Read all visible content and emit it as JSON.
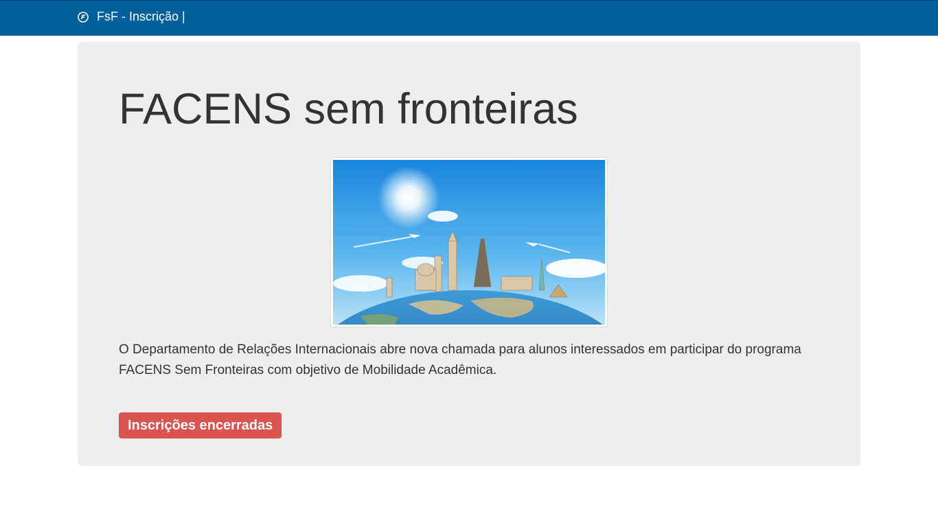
{
  "navbar": {
    "brand_label": "FsF - Inscrição |",
    "brand_icon": "facens-logo-icon",
    "background_color": "#04609c"
  },
  "main": {
    "title": "FACENS sem fronteiras",
    "hero_image": "world-landmarks-globe-image",
    "description": "O Departamento de Relações Internacionais abre nova chamada para alunos interessados em participar do programa FACENS Sem Fronteiras com objetivo de Mobilidade Acadêmica.",
    "status_button_label": "Inscrições encerradas",
    "status_button_color": "#d9534f"
  }
}
